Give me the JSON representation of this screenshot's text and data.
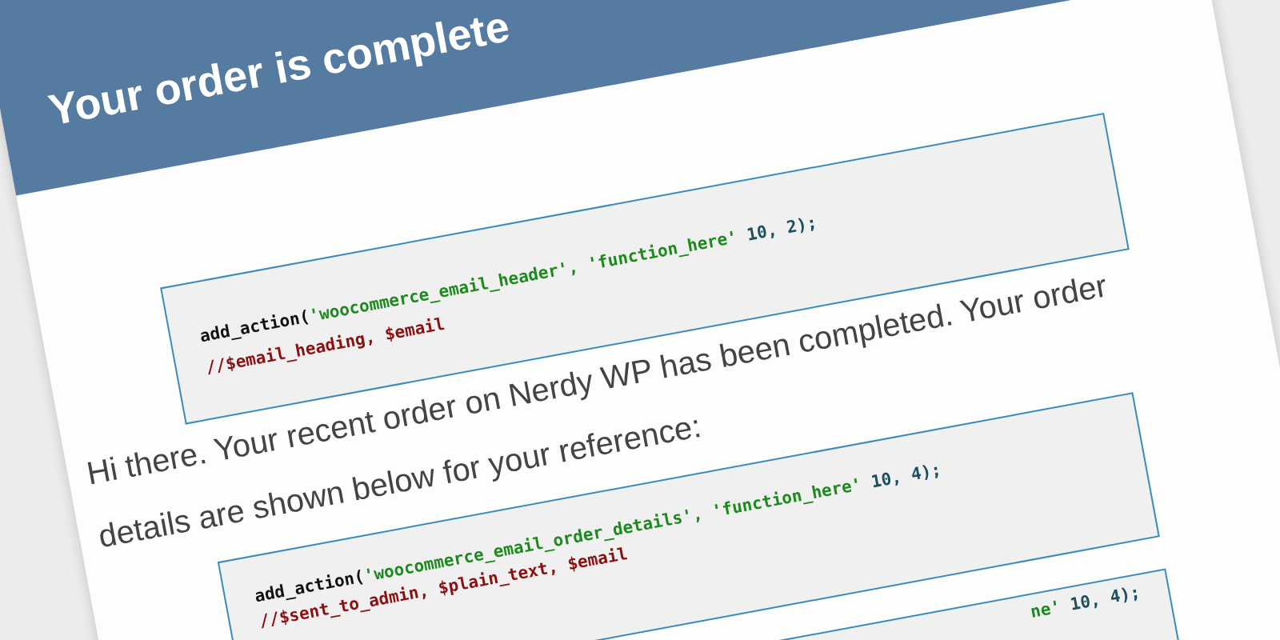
{
  "header": {
    "title": "Your order is complete"
  },
  "code_blocks": [
    {
      "lines": [
        [
          {
            "kind": "fn",
            "text": "add_action("
          },
          {
            "kind": "str",
            "text": "'woocommerce_email_header', 'function_here'"
          },
          {
            "kind": "num",
            "text": " 10, 2);"
          }
        ],
        [
          {
            "kind": "var",
            "text": "//$email_heading, $email"
          }
        ]
      ]
    },
    {
      "lines": [
        [
          {
            "kind": "fn",
            "text": "add_action("
          },
          {
            "kind": "str",
            "text": "'woocommerce_email_order_details', 'function_here'"
          },
          {
            "kind": "num",
            "text": " 10, 4);"
          }
        ],
        [
          {
            "kind": "var",
            "text": "//$sent_to_admin, $plain_text, $email"
          }
        ]
      ]
    },
    {
      "lines": [
        [
          {
            "kind": "str",
            "text": "ne'"
          },
          {
            "kind": "num",
            "text": " 10, 4);"
          }
        ]
      ]
    }
  ],
  "message": "Hi there. Your recent order on Nerdy WP has been completed. Your order details are shown below for your reference:"
}
